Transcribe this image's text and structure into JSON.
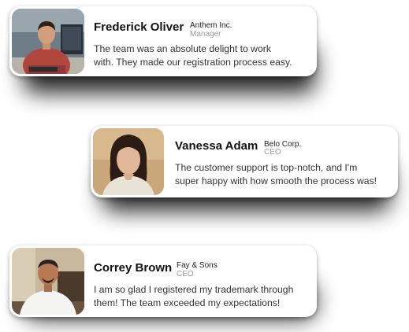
{
  "testimonials": [
    {
      "name": "Frederick Oliver",
      "company": "Anthem Inc.",
      "role": "Manager",
      "quote_lines": [
        "The team was an absolute delight to work",
        "with. They made our registration process easy."
      ]
    },
    {
      "name": "Vanessa Adam",
      "company": "Belo Corp.",
      "role": "CEO",
      "quote_lines": [
        "The customer support is top-notch, and I'm",
        "super happy with how smooth the process was!"
      ]
    },
    {
      "name": "Correy Brown",
      "company": "Fay & Sons",
      "role": "CEO",
      "quote_lines": [
        "I am so glad I registered my trademark through",
        "them! The team exceeded my expectations!"
      ]
    }
  ]
}
